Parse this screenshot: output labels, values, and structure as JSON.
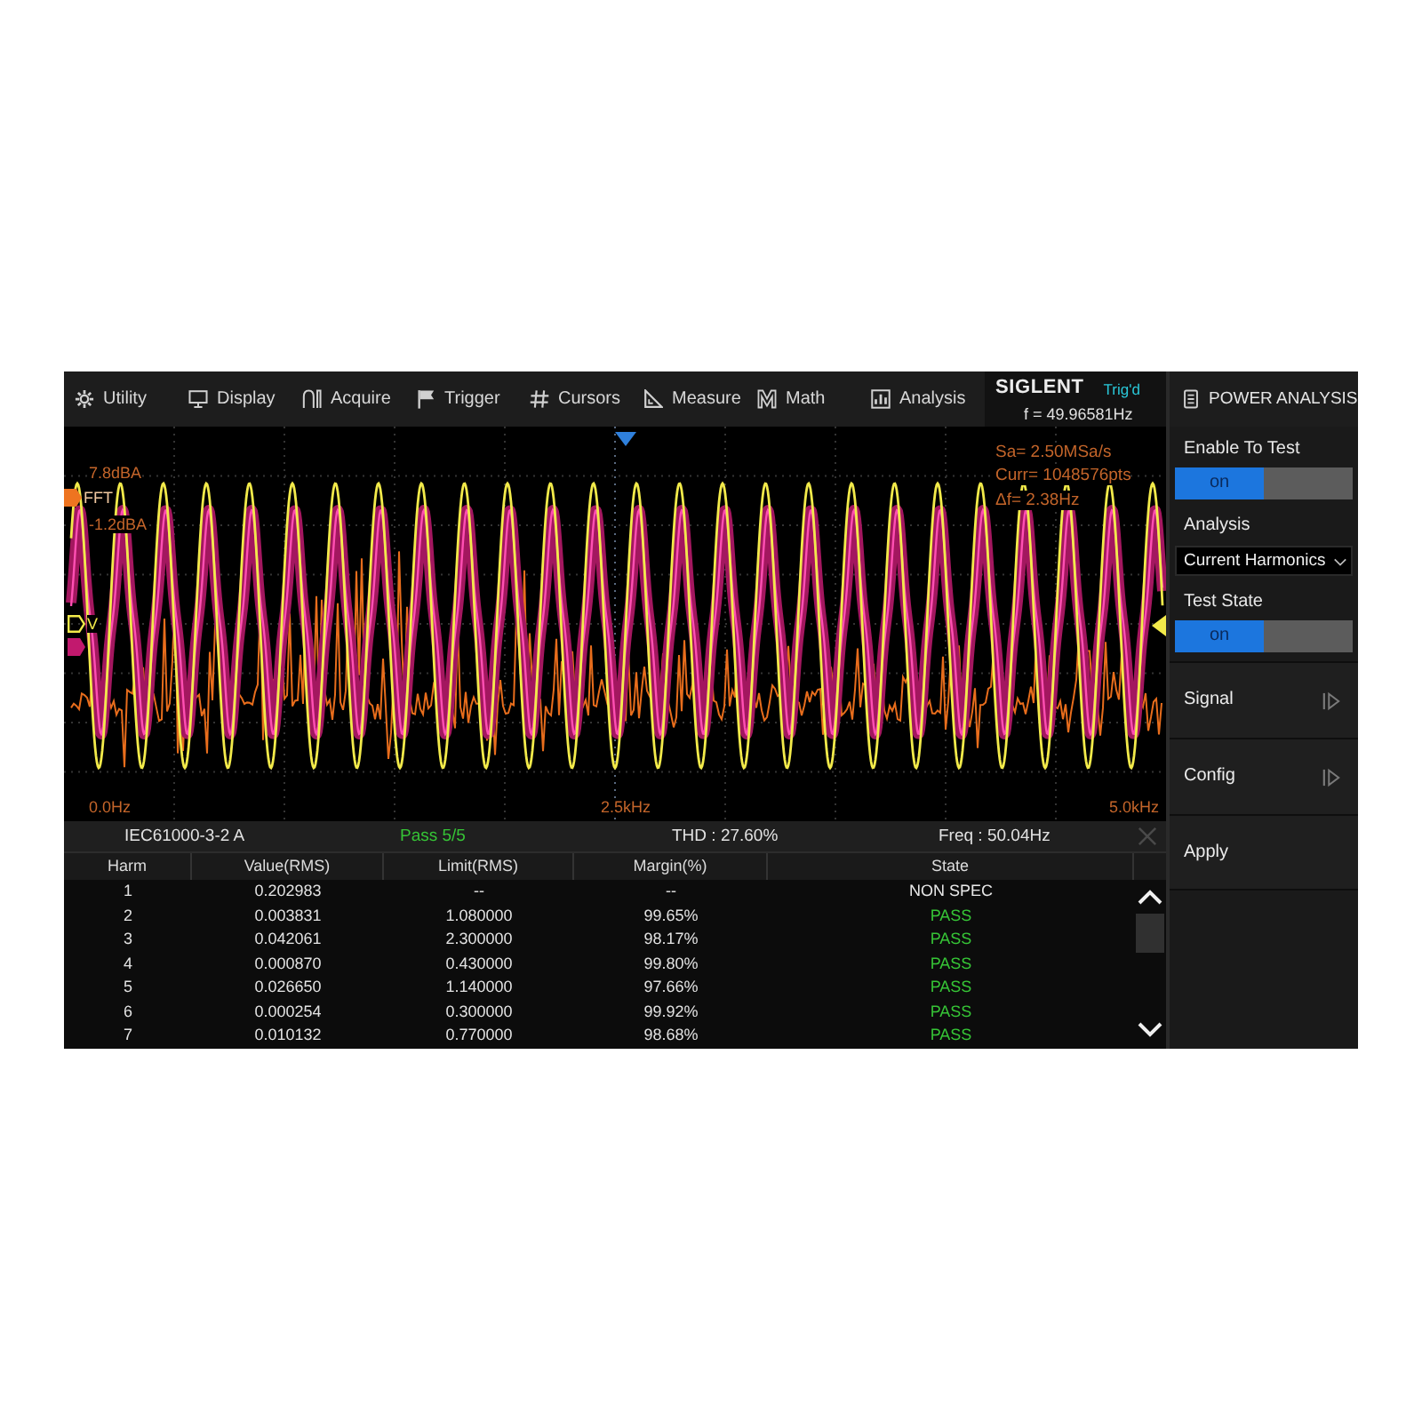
{
  "menu": [
    "Utility",
    "Display",
    "Acquire",
    "Trigger",
    "Cursors",
    "Measure",
    "Math",
    "Analysis"
  ],
  "scope_status": {
    "brand": "SIGLENT",
    "trigger_status": "Trig'd",
    "frequency": "f = 49.96581Hz"
  },
  "waveform": {
    "channel_tags": [
      {
        "kind": "fft",
        "label": "FFT"
      },
      {
        "kind": "voltage",
        "label": "V"
      },
      {
        "kind": "current"
      }
    ],
    "scale_labels": [
      "7.8dBA",
      "-1.2dBA"
    ],
    "acquisition": [
      "Sa= 2.50MSa/s",
      "Curr= 1048576pts",
      "Δf= 2.38Hz"
    ],
    "axis_labels": [
      "0.0Hz",
      "2.5kHz",
      "5.0kHz"
    ]
  },
  "results": {
    "standard": "IEC61000-3-2 A",
    "verdict": "Pass 5/5",
    "thd": "THD : 27.60%",
    "frequency": "Freq : 50.04Hz",
    "columns": [
      "Harm",
      "Value(RMS)",
      "Limit(RMS)",
      "Margin(%)",
      "State"
    ],
    "rows": [
      {
        "cells": [
          "1",
          "0.202983",
          "--",
          "--",
          "NON SPEC"
        ],
        "passed": false
      },
      {
        "cells": [
          "2",
          "0.003831",
          "1.080000",
          "99.65%",
          "PASS"
        ],
        "passed": true
      },
      {
        "cells": [
          "3",
          "0.042061",
          "2.300000",
          "98.17%",
          "PASS"
        ],
        "passed": true
      },
      {
        "cells": [
          "4",
          "0.000870",
          "0.430000",
          "99.80%",
          "PASS"
        ],
        "passed": true
      },
      {
        "cells": [
          "5",
          "0.026650",
          "1.140000",
          "97.66%",
          "PASS"
        ],
        "passed": true
      },
      {
        "cells": [
          "6",
          "0.000254",
          "0.300000",
          "99.92%",
          "PASS"
        ],
        "passed": true
      },
      {
        "cells": [
          "7",
          "0.010132",
          "0.770000",
          "98.68%",
          "PASS"
        ],
        "passed": true
      }
    ]
  },
  "side_panel": {
    "title": "POWER ANALYSIS",
    "items": [
      {
        "kind": "toggle",
        "label": "Enable To Test",
        "value": "on",
        "on": true
      },
      {
        "kind": "dropdown",
        "label": "Analysis",
        "value": "Current Harmonics"
      },
      {
        "kind": "toggle",
        "label": "Test State",
        "value": "on",
        "on": true
      },
      {
        "kind": "submenu",
        "label": "Signal"
      },
      {
        "kind": "submenu",
        "label": "Config"
      },
      {
        "kind": "action",
        "label": "Apply"
      }
    ]
  }
}
